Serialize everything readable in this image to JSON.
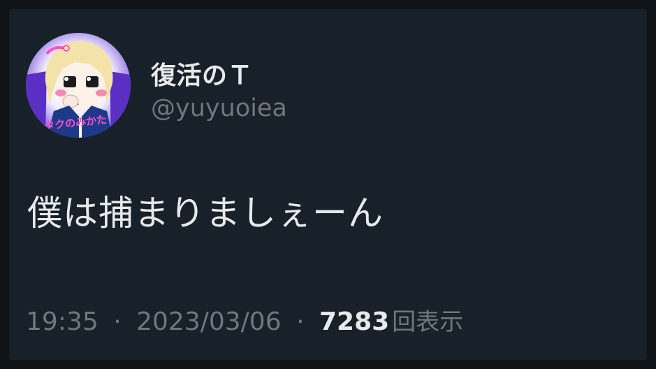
{
  "tweet": {
    "author": {
      "display_name": "復活のＴ",
      "handle": "@yuyuoiea",
      "avatar_text": "オタクのみかた"
    },
    "text": "僕は捕まりましぇーん",
    "time": "19:35",
    "separator": "·",
    "date": "2023/03/06",
    "views_count": "7283",
    "views_label": "回表示"
  },
  "colors": {
    "background": "#18202a",
    "primary_text": "#e7e9ea",
    "secondary_text": "#71767b"
  }
}
